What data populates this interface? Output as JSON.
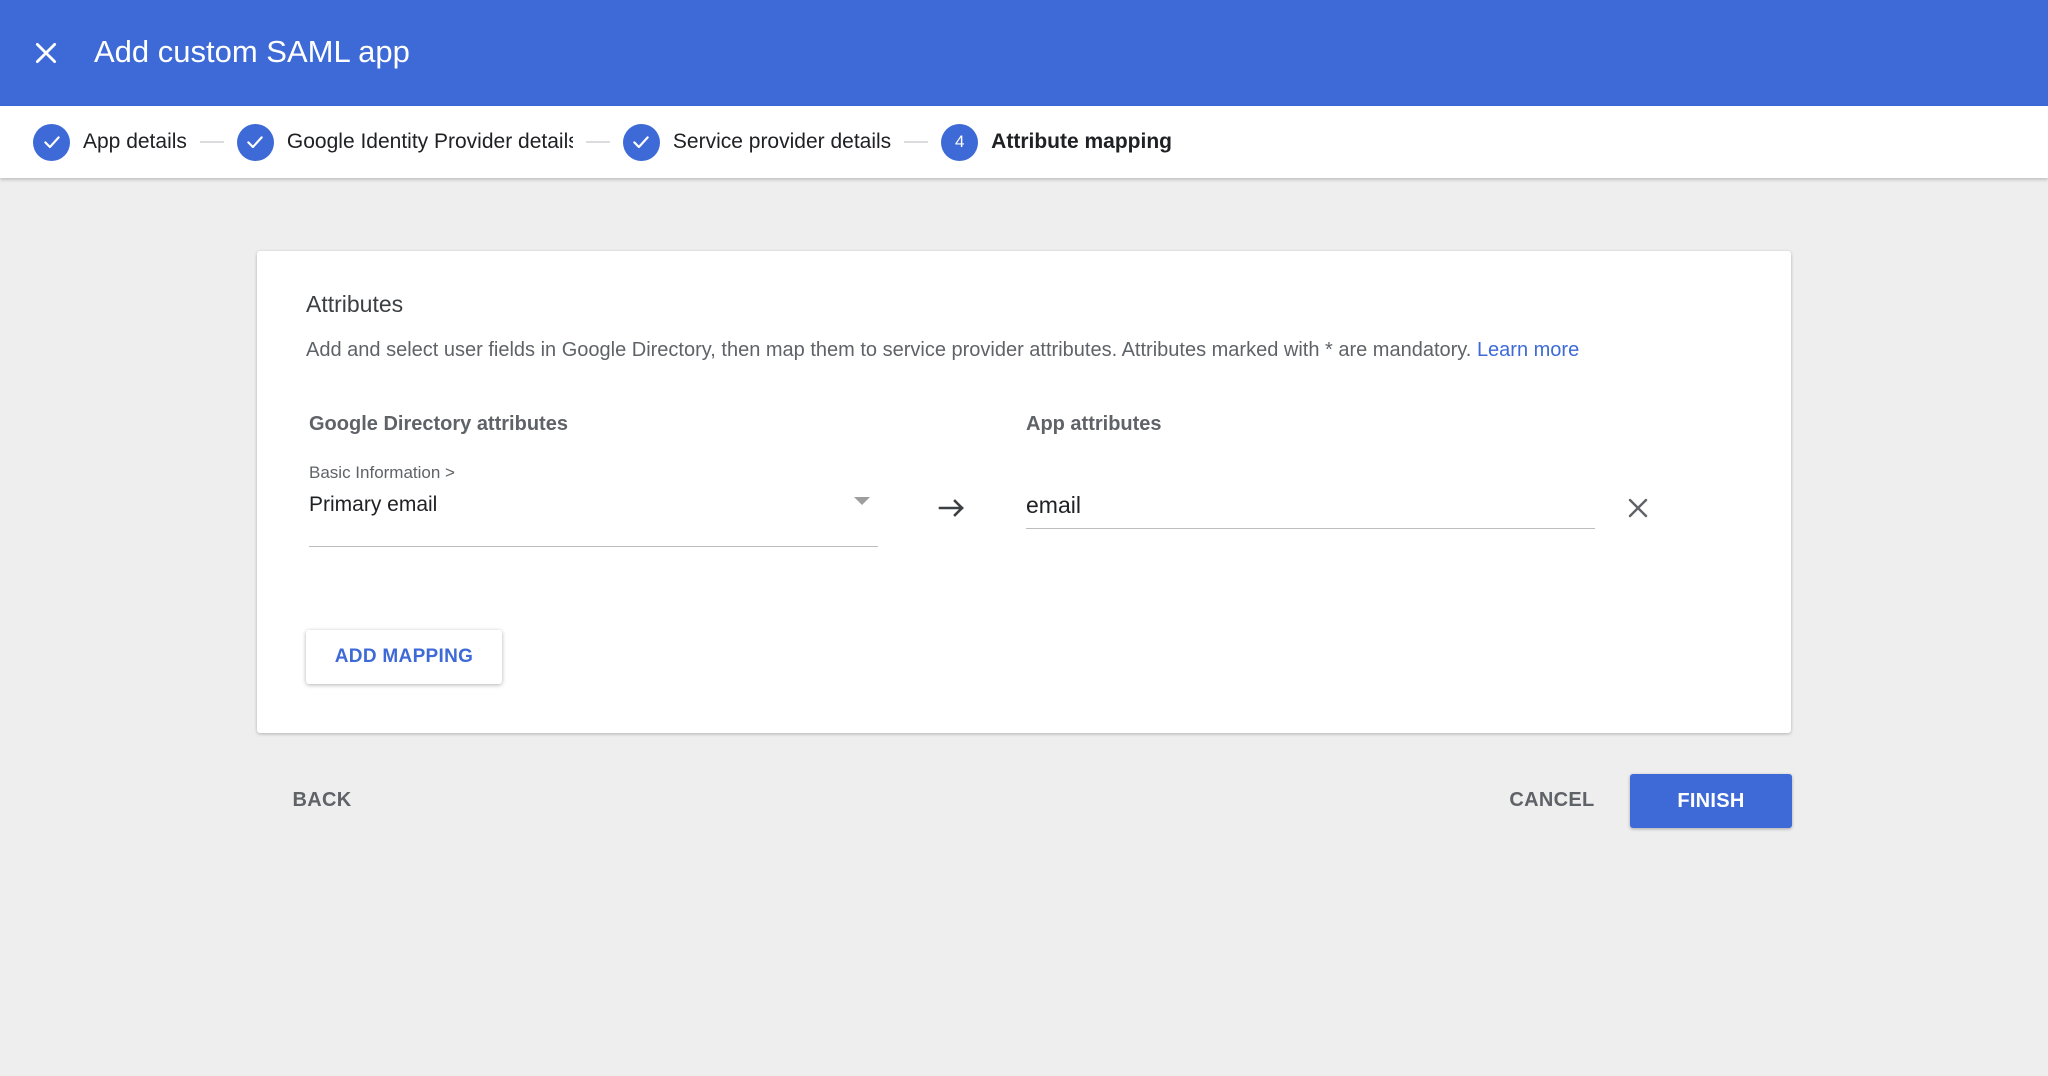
{
  "header": {
    "title": "Add custom SAML app",
    "close_icon": "close-icon",
    "background_color": "#3d6ad6"
  },
  "stepper": {
    "steps": [
      {
        "label": "App details",
        "status": "complete",
        "icon": "check-icon"
      },
      {
        "label": "Google Identity Provider details",
        "status": "complete",
        "icon": "check-icon"
      },
      {
        "label": "Service provider details",
        "status": "complete",
        "icon": "check-icon"
      },
      {
        "label": "Attribute mapping",
        "status": "active",
        "number": "4"
      }
    ]
  },
  "card": {
    "title": "Attributes",
    "description": "Add and select user fields in Google Directory, then map them to service provider attributes. Attributes marked with * are mandatory.",
    "learn_more": "Learn more",
    "left_column_header": "Google Directory attributes",
    "right_column_header": "App attributes",
    "mapping": {
      "directory_category": "Basic Information >",
      "directory_value": "Primary email",
      "arrow_icon": "arrow-right-icon",
      "app_attribute_value": "email",
      "remove_icon": "close-icon"
    },
    "add_mapping_label": "ADD MAPPING"
  },
  "footer": {
    "back_label": "BACK",
    "cancel_label": "CANCEL",
    "finish_label": "FINISH"
  }
}
